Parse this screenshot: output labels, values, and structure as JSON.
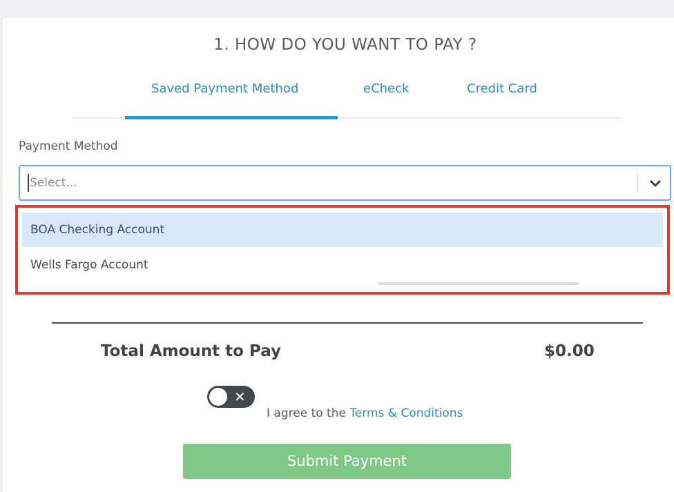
{
  "heading": "1. HOW DO YOU WANT TO PAY ?",
  "tabs": [
    {
      "label": "Saved Payment Method",
      "active": true
    },
    {
      "label": "eCheck",
      "active": false
    },
    {
      "label": "Credit Card",
      "active": false
    }
  ],
  "payment_method": {
    "label": "Payment Method",
    "placeholder": "Select...",
    "options": [
      "BOA Checking Account",
      "Wells Fargo Account"
    ],
    "highlighted_option": "BOA Checking Account",
    "icon": "chevron-down-icon"
  },
  "total": {
    "label": "Total Amount to Pay",
    "value": "$0.00"
  },
  "agreement": {
    "prefix": "I agree to the ",
    "link": "Terms & Conditions",
    "toggle_icon": "close-icon",
    "toggle_on": false
  },
  "submit_label": "Submit Payment",
  "colors": {
    "accent": "#2b8fb8",
    "highlight_box": "#e33a30",
    "submit": "#7fc987",
    "option_highlight": "#d9e7fb"
  }
}
